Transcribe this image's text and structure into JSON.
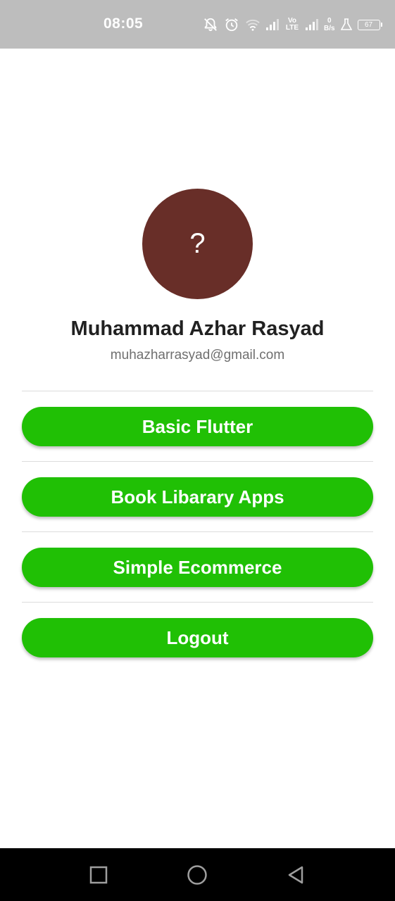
{
  "status_bar": {
    "time": "08:05",
    "network_type": "Vo LTE",
    "net_speed_value": "0",
    "net_speed_unit": "B/s",
    "battery_level": "67",
    "icons": [
      "notifications-off-icon",
      "alarm-icon",
      "wifi-icon",
      "signal-icon",
      "volte-icon",
      "signal-icon",
      "net-speed-icon",
      "lab-icon",
      "battery-icon"
    ]
  },
  "profile": {
    "avatar_placeholder": "?",
    "name": "Muhammad Azhar Rasyad",
    "email": "muhazharrasyad@gmail.com",
    "avatar_color": "#682e28"
  },
  "menu": {
    "buttons": [
      {
        "label": "Basic Flutter"
      },
      {
        "label": "Book Libarary Apps"
      },
      {
        "label": "Simple Ecommerce"
      },
      {
        "label": "Logout"
      }
    ],
    "button_color": "#20c005"
  },
  "nav_bar": {
    "items": [
      "recents-icon",
      "home-icon",
      "back-icon"
    ]
  }
}
